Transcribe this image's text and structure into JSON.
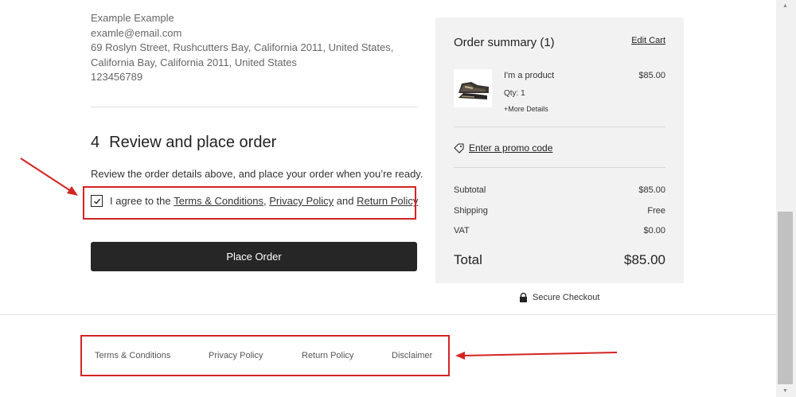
{
  "shipping_address": {
    "name": "Example Example",
    "email": "examle@email.com",
    "street": "69 Roslyn Street, Rushcutters Bay, California 2011, United States,",
    "city": "California Bay, California 2011, United States",
    "phone": "123456789"
  },
  "review_step": {
    "number": "4",
    "title": "Review and place order",
    "instruction": "Review the order details above, and place your order when you’re ready.",
    "agree_prefix": "I agree to the",
    "terms_link": "Terms & Conditions",
    "comma": ",",
    "privacy_link": "Privacy Policy",
    "and": "and",
    "return_link": "Return Policy",
    "checked": true,
    "place_order_label": "Place Order"
  },
  "order_summary": {
    "title": "Order summary (1)",
    "edit_cart": "Edit Cart",
    "product": {
      "name": "I'm a product",
      "price": "$85.00",
      "qty": "Qty: 1",
      "more_details": "+More Details"
    },
    "promo_label": "Enter a promo code",
    "rows": [
      {
        "label": "Subtotal",
        "value": "$85.00"
      },
      {
        "label": "Shipping",
        "value": "Free"
      },
      {
        "label": "VAT",
        "value": "$0.00"
      }
    ],
    "total_label": "Total",
    "total_value": "$85.00"
  },
  "secure_checkout": "Secure Checkout",
  "footer_links": [
    "Terms & Conditions",
    "Privacy Policy",
    "Return Policy",
    "Disclaimer"
  ],
  "icons": {
    "check": "check-icon",
    "tag": "tag-icon",
    "lock": "lock-icon"
  },
  "colors": {
    "annotation": "#d42424",
    "button": "#262626",
    "summary_bg": "#f2f2f2"
  }
}
